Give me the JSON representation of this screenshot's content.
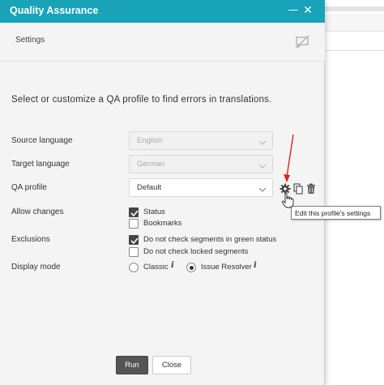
{
  "dialog": {
    "title": "Quality Assurance",
    "minimize_symbol": "—",
    "close_symbol": "✕",
    "settings_label": "Settings",
    "intro_text": "Select or customize a QA profile to find errors in translations."
  },
  "form": {
    "source_language": {
      "label": "Source language",
      "value": "English"
    },
    "target_language": {
      "label": "Target language",
      "value": "German"
    },
    "qa_profile": {
      "label": "QA profile",
      "value": "Default"
    },
    "allow_changes": {
      "label": "Allow changes",
      "options": [
        {
          "label": "Status",
          "checked": true
        },
        {
          "label": "Bookmarks",
          "checked": false
        }
      ]
    },
    "exclusions": {
      "label": "Exclusions",
      "options": [
        {
          "label": "Do not check segments in green status",
          "checked": true
        },
        {
          "label": "Do not check locked segments",
          "checked": false
        }
      ]
    },
    "display_mode": {
      "label": "Display mode",
      "options": [
        {
          "label": "Classic",
          "selected": false
        },
        {
          "label": "Issue Resolver",
          "selected": true
        }
      ],
      "info_symbol": "i"
    }
  },
  "tooltip": {
    "text": "Edit this profile's settings"
  },
  "buttons": {
    "run": "Run",
    "close": "Close"
  },
  "icons": {
    "settings_gear": "gear-icon",
    "copy": "copy-icon",
    "delete": "trash-icon",
    "chat_off": "chat-off-icon",
    "chevron": "chevron-down-icon"
  },
  "colors": {
    "titlebar": "#18a3b9",
    "run_button": "#555555",
    "annotation_arrow": "#e02020"
  }
}
